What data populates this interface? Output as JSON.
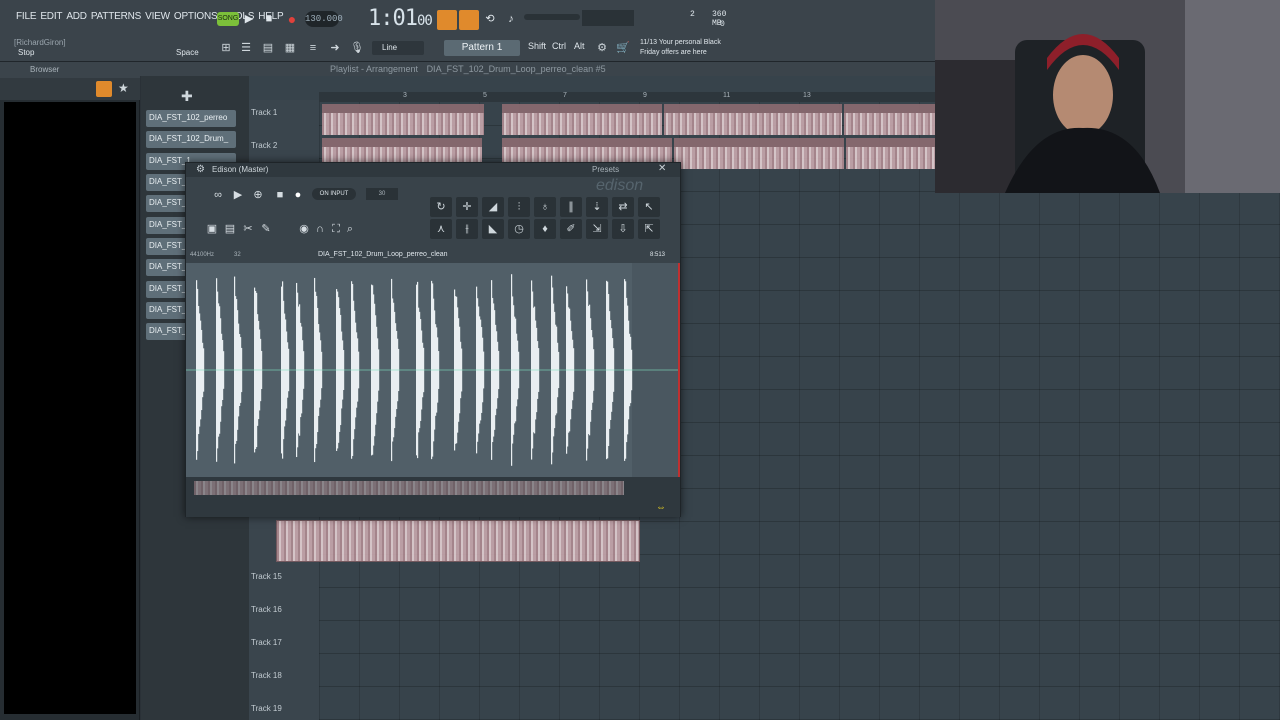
{
  "menu": [
    "FILE",
    "EDIT",
    "ADD",
    "PATTERNS",
    "VIEW",
    "OPTIONS",
    "TOOLS",
    "HELP"
  ],
  "transport": {
    "song_label": "SONG",
    "tempo": "130.000",
    "time": "1:01",
    "time_sub": "00",
    "cpu_count": "2",
    "mem": "360 MB",
    "voices": "0"
  },
  "hint": {
    "user": "[RichardGiron]",
    "action": "Stop",
    "key": "Space"
  },
  "toolbar": {
    "snap": "Line",
    "pattern": "Pattern 1",
    "shift": "Shift",
    "ctrl": "Ctrl",
    "alt": "Alt"
  },
  "news": {
    "date": "11/13",
    "line1": "Your personal Black",
    "line2": "Friday offers are here"
  },
  "browser": {
    "title": "Browser"
  },
  "playlist": {
    "title": "Playlist - Arrangement",
    "clip_name": "DIA_FST_102_Drum_Loop_perreo_clean #5",
    "tracks": [
      "Track 1",
      "Track 2",
      "Track 15",
      "Track 16",
      "Track 17",
      "Track 18",
      "Track 19"
    ],
    "clip_track1": [
      "DIA_FST_102_perreo_bass_high_C#min",
      "DIA_FST_102_perreo_bass_high_C#min #2",
      "DIA_FST_102_perreo_bass_high_C#min #3",
      "DIA_FST_102_perreo_ba"
    ],
    "clip_track2": [
      "DIA_FST_102_Drum_Loop_perreo_clean",
      "DIA_FST_102_Drum_Loop_perreo_clean #2",
      "DIA_FST_102_Drum_Loop_perreo_clean #4",
      "DIA_FST_102_Drum_Loo"
    ],
    "ruler": [
      "3",
      "5",
      "7",
      "9",
      "11",
      "13"
    ]
  },
  "channels": [
    "DIA_FST_102_perreo",
    "DIA_FST_102_Drum_",
    "DIA_FST_1",
    "DIA_FST_1",
    "DIA_FST_1",
    "DIA_FST_1",
    "DIA_FST_1",
    "DIA_FST_1",
    "DIA_FST_1",
    "DIA_FST_1",
    "DIA_FST_1"
  ],
  "edison": {
    "title": "Edison (Master)",
    "presets": "Presets",
    "on_input": "ON INPUT",
    "input_val": "30",
    "logo": "edison",
    "sample_rate": "44100Hz",
    "bits": "32",
    "file_name": "DIA_FST_102_Drum_Loop_perreo_clean",
    "length": "8:513"
  },
  "colors": {
    "accent": "#e08a2c",
    "song": "#7cc03a",
    "record": "#e0413b",
    "clip": "#c9a8ae"
  }
}
